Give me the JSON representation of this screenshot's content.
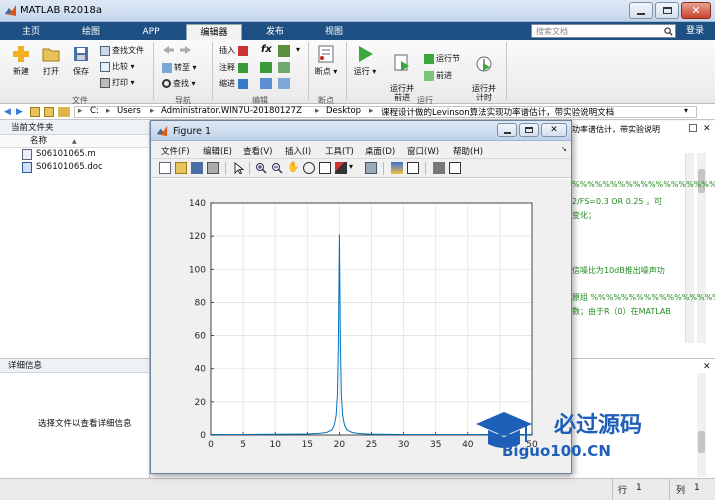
{
  "app": {
    "title": "MATLAB R2018a"
  },
  "tabs": [
    "主页",
    "绘图",
    "APP",
    "编辑器",
    "发布",
    "视图"
  ],
  "active_tab": "编辑器",
  "search": {
    "placeholder": "搜索文档"
  },
  "login": "登录",
  "ribbon": {
    "file": {
      "new": "新建",
      "open": "打开",
      "save": "保存",
      "find_files": "查找文件",
      "compare": "比较",
      "print": "打印",
      "group": "文件"
    },
    "nav": {
      "goto": "转至",
      "find": "查找",
      "group": "导航"
    },
    "edit": {
      "insert": "插入",
      "comment": "注释",
      "indent": "缩进",
      "fx": "fx",
      "group": "编辑"
    },
    "breakpoints": {
      "label": "断点",
      "group": "断点"
    },
    "run": {
      "run": "运行",
      "run_advance": "运行并\n前进",
      "run_section": "运行节",
      "advance": "前进",
      "run_time": "运行并\n计时",
      "group": "运行"
    }
  },
  "address": {
    "parts": [
      "C:",
      "Users",
      "Administrator.WIN7U-20180127Z",
      "Desktop",
      "课程设计做的Levinson算法实现功率谱估计，带实验说明文档"
    ]
  },
  "current_folder": {
    "title": "当前文件夹",
    "column": "名称",
    "column_sort": "▲",
    "files": [
      {
        "name": "S06101065.m",
        "type": "m"
      },
      {
        "name": "S06101065.doc",
        "type": "doc"
      }
    ]
  },
  "details": {
    "title": "详细信息",
    "hint": "选择文件以查看详细信息"
  },
  "editor_code": [
    "功率谱估计，带实验说明",
    "%%%%%%%%%%%%%%%%%%%%%%%%",
    "2/FS=0.3 OR 0.25 ，可",
    "变化；",
    "信噪比为10dB推出噪声功",
    "原组 %%%%%%%%%%%%%%%%%%",
    "数；由于R（0）在MATLAB"
  ],
  "status": {
    "row_label": "行",
    "row": "1",
    "col_label": "列",
    "col": "1"
  },
  "figure": {
    "title": "Figure 1",
    "menu": [
      "文件(F)",
      "编辑(E)",
      "查看(V)",
      "插入(I)",
      "工具(T)",
      "桌面(D)",
      "窗口(W)",
      "帮助(H)"
    ]
  },
  "chart_data": {
    "type": "line",
    "title": "",
    "xlabel": "",
    "ylabel": "",
    "xlim": [
      0,
      50
    ],
    "ylim": [
      0,
      140
    ],
    "xticks": [
      0,
      5,
      10,
      15,
      20,
      25,
      30,
      35,
      40,
      45,
      50
    ],
    "yticks": [
      0,
      20,
      40,
      60,
      80,
      100,
      120,
      140
    ],
    "grid": true,
    "series": [
      {
        "color": "#0072bd",
        "x": [
          0,
          5,
          10,
          15,
          17,
          18,
          18.8,
          19.2,
          19.5,
          19.7,
          19.85,
          20.0,
          20.15,
          20.3,
          20.5,
          20.8,
          21.2,
          22,
          23,
          25,
          30,
          35,
          40,
          45,
          50
        ],
        "y": [
          0.3,
          0.3,
          0.4,
          0.6,
          1.0,
          1.5,
          3,
          6,
          12,
          25,
          55,
          121,
          55,
          25,
          12,
          6,
          3,
          1.5,
          0.9,
          0.5,
          0.3,
          0.3,
          0.3,
          0.3,
          0.3
        ]
      }
    ]
  },
  "watermark": {
    "text1": "必过源码",
    "text2": "Biguo100.CN"
  }
}
